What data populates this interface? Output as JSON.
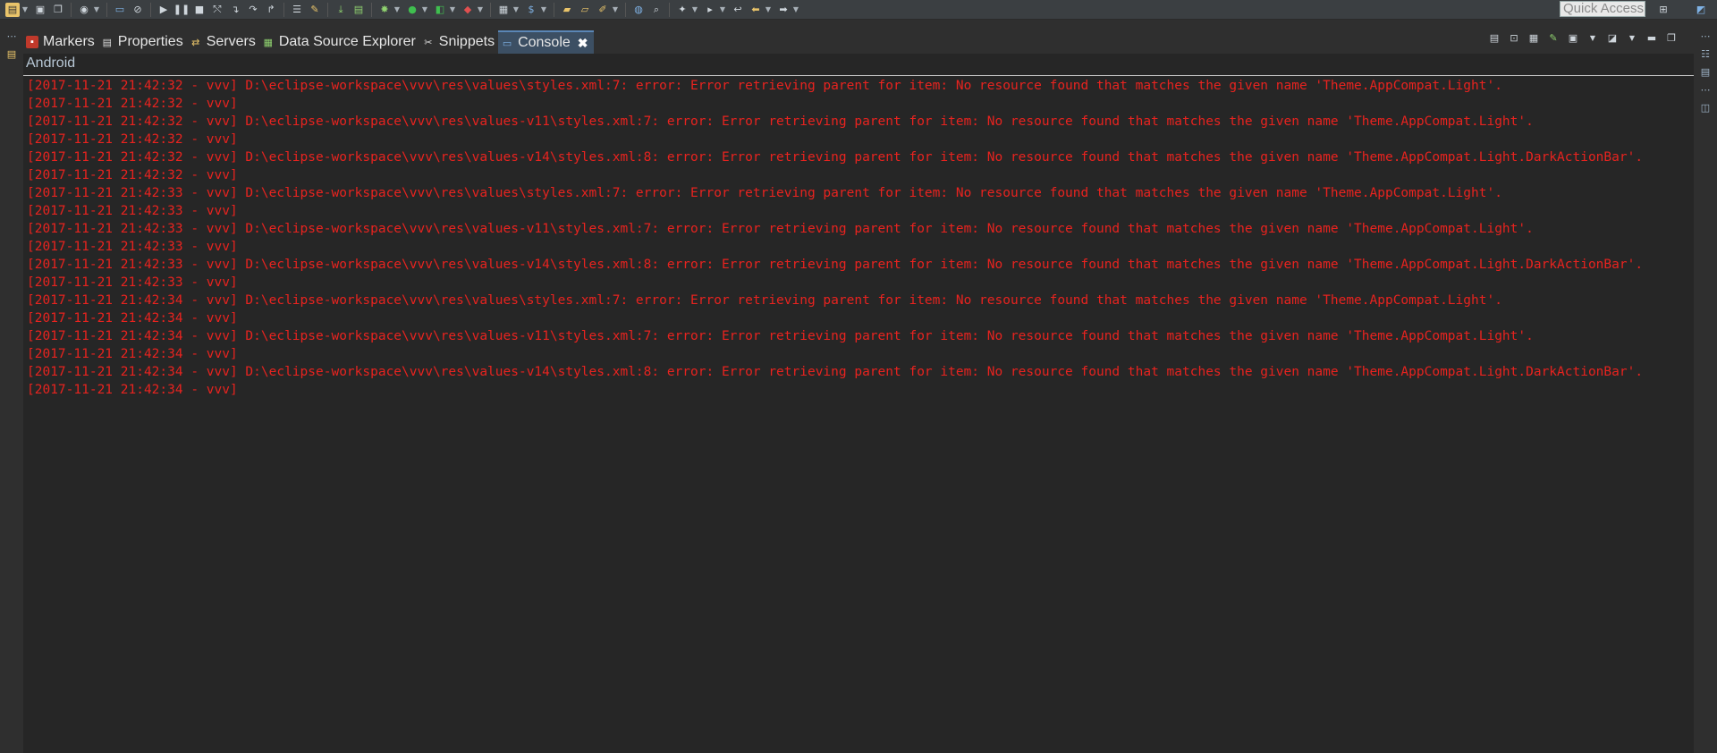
{
  "toolbar": {
    "quick_access_placeholder": "Quick Access"
  },
  "tabs": [
    {
      "label": "Markers",
      "icon": "markers-icon",
      "active": false
    },
    {
      "label": "Properties",
      "icon": "properties-icon",
      "active": false
    },
    {
      "label": "Servers",
      "icon": "servers-icon",
      "active": false
    },
    {
      "label": "Data Source Explorer",
      "icon": "data-source-icon",
      "active": false
    },
    {
      "label": "Snippets",
      "icon": "snippets-icon",
      "active": false
    },
    {
      "label": "Console",
      "icon": "console-icon",
      "active": true,
      "close": "✖"
    }
  ],
  "console": {
    "title": "Android",
    "lines": [
      "[2017-11-21 21:42:32 - vvv] D:\\eclipse-workspace\\vvv\\res\\values\\styles.xml:7: error: Error retrieving parent for item: No resource found that matches the given name 'Theme.AppCompat.Light'.",
      "[2017-11-21 21:42:32 - vvv]",
      "[2017-11-21 21:42:32 - vvv] D:\\eclipse-workspace\\vvv\\res\\values-v11\\styles.xml:7: error: Error retrieving parent for item: No resource found that matches the given name 'Theme.AppCompat.Light'.",
      "[2017-11-21 21:42:32 - vvv]",
      "[2017-11-21 21:42:32 - vvv] D:\\eclipse-workspace\\vvv\\res\\values-v14\\styles.xml:8: error: Error retrieving parent for item: No resource found that matches the given name 'Theme.AppCompat.Light.DarkActionBar'.",
      "[2017-11-21 21:42:32 - vvv]",
      "[2017-11-21 21:42:33 - vvv] D:\\eclipse-workspace\\vvv\\res\\values\\styles.xml:7: error: Error retrieving parent for item: No resource found that matches the given name 'Theme.AppCompat.Light'.",
      "[2017-11-21 21:42:33 - vvv]",
      "[2017-11-21 21:42:33 - vvv] D:\\eclipse-workspace\\vvv\\res\\values-v11\\styles.xml:7: error: Error retrieving parent for item: No resource found that matches the given name 'Theme.AppCompat.Light'.",
      "[2017-11-21 21:42:33 - vvv]",
      "[2017-11-21 21:42:33 - vvv] D:\\eclipse-workspace\\vvv\\res\\values-v14\\styles.xml:8: error: Error retrieving parent for item: No resource found that matches the given name 'Theme.AppCompat.Light.DarkActionBar'.",
      "[2017-11-21 21:42:33 - vvv]",
      "[2017-11-21 21:42:34 - vvv] D:\\eclipse-workspace\\vvv\\res\\values\\styles.xml:7: error: Error retrieving parent for item: No resource found that matches the given name 'Theme.AppCompat.Light'.",
      "[2017-11-21 21:42:34 - vvv]",
      "[2017-11-21 21:42:34 - vvv] D:\\eclipse-workspace\\vvv\\res\\values-v11\\styles.xml:7: error: Error retrieving parent for item: No resource found that matches the given name 'Theme.AppCompat.Light'.",
      "[2017-11-21 21:42:34 - vvv]",
      "[2017-11-21 21:42:34 - vvv] D:\\eclipse-workspace\\vvv\\res\\values-v14\\styles.xml:8: error: Error retrieving parent for item: No resource found that matches the given name 'Theme.AppCompat.Light.DarkActionBar'.",
      "[2017-11-21 21:42:34 - vvv]"
    ]
  },
  "colors": {
    "error_text": "#e8231f",
    "active_tab": "#3c4f63",
    "console_bg": "#262626"
  }
}
